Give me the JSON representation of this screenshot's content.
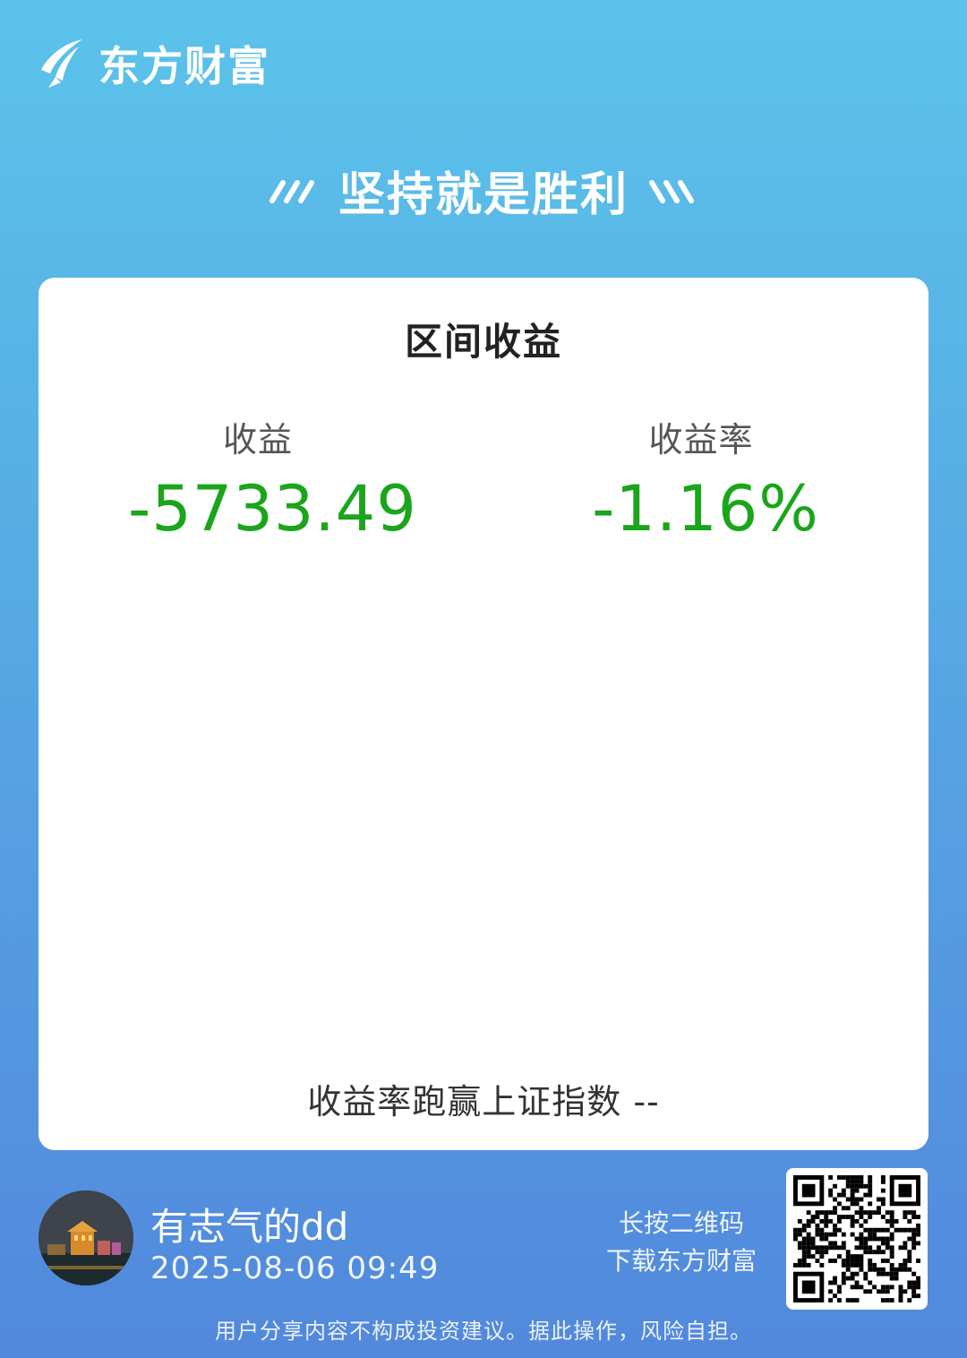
{
  "brand": {
    "name": "东方财富",
    "logo_icon": "eastmoney-feather-logo-icon"
  },
  "slogan": {
    "text": "坚持就是胜利",
    "left_deco": "triple-slash-icon",
    "right_deco": "triple-backslash-icon"
  },
  "card": {
    "title": "区间收益",
    "profit": {
      "label": "收益",
      "value": "-5733.49"
    },
    "rate": {
      "label": "收益率",
      "value": "-1.16%"
    },
    "beat_index": "收益率跑赢上证指数 --"
  },
  "user": {
    "name": "有志气的dd",
    "datetime": "2025-08-06 09:49",
    "avatar_icon": "avatar-night-city-photo"
  },
  "qr": {
    "hint_line1": "长按二维码",
    "hint_line2": "下载东方财富",
    "icon": "qr-code-icon"
  },
  "disclaimer": "用户分享内容不构成投资建议。据此操作，风险自担。",
  "colors": {
    "gain_loss": "#1aa51a",
    "bg_top": "#5bc3ea",
    "bg_bottom": "#5288dc"
  }
}
